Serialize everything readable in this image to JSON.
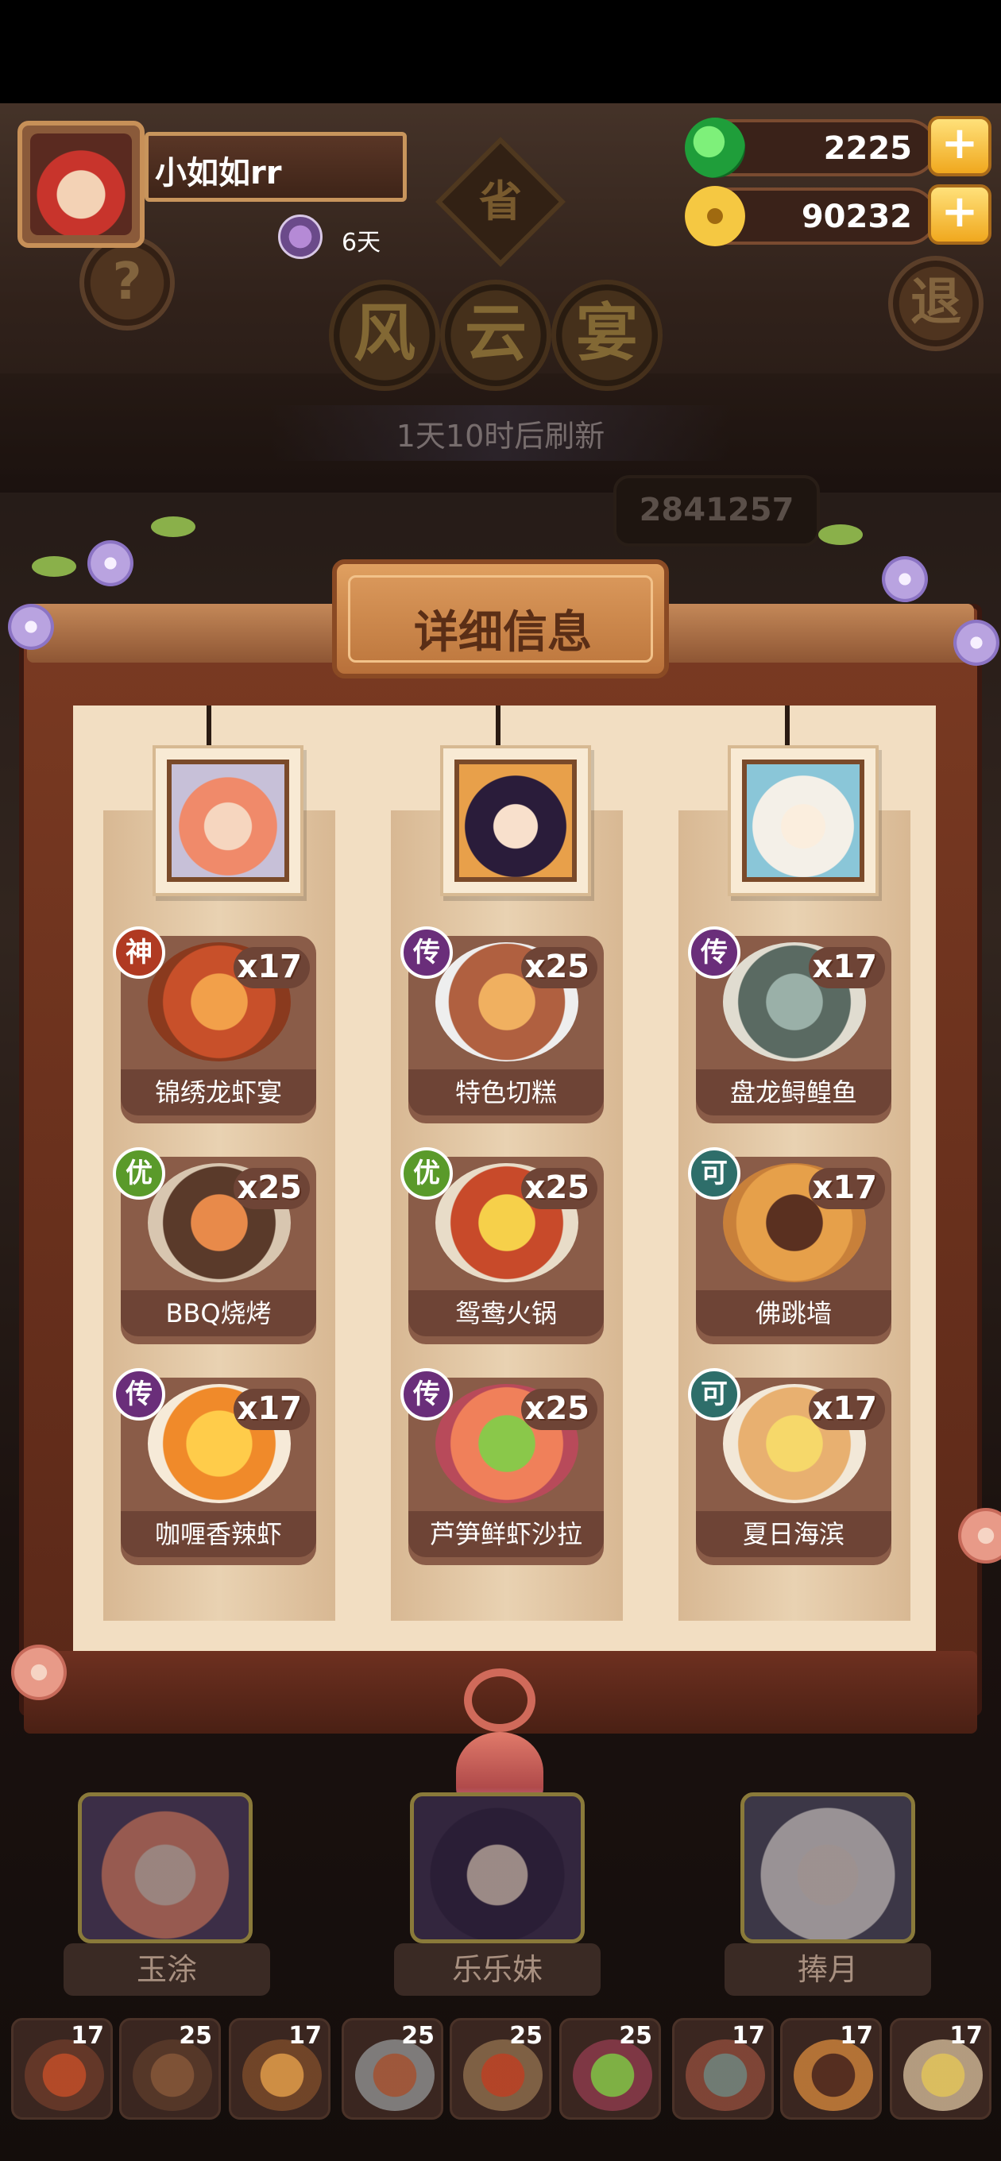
{
  "player": {
    "name": "小如如rr",
    "days": "6天"
  },
  "resources": {
    "jade": "2225",
    "coins": "90232",
    "plus": "+"
  },
  "buttons": {
    "help": "?",
    "exit": "退"
  },
  "event": {
    "province": "省",
    "title_chars": [
      "风",
      "云",
      "宴"
    ],
    "refresh": "1天10时后刷新",
    "score": "2841257"
  },
  "panel": {
    "title": "详细信息",
    "columns": [
      {
        "character": "玉涂",
        "dishes": [
          {
            "rank": "神",
            "count": "x17",
            "name": "锦绣龙虾宴"
          },
          {
            "rank": "优",
            "count": "x25",
            "name": "BBQ烧烤"
          },
          {
            "rank": "传",
            "count": "x17",
            "name": "咖喱香辣虾"
          }
        ]
      },
      {
        "character": "乐乐妹",
        "dishes": [
          {
            "rank": "传",
            "count": "x25",
            "name": "特色切糕"
          },
          {
            "rank": "优",
            "count": "x25",
            "name": "鸳鸯火锅"
          },
          {
            "rank": "传",
            "count": "x25",
            "name": "芦笋鲜虾沙拉"
          }
        ]
      },
      {
        "character": "捧月",
        "dishes": [
          {
            "rank": "传",
            "count": "x17",
            "name": "盘龙鲟鳇鱼"
          },
          {
            "rank": "可",
            "count": "x17",
            "name": "佛跳墙"
          },
          {
            "rank": "可",
            "count": "x17",
            "name": "夏日海滨"
          }
        ]
      }
    ]
  },
  "characters": [
    "玉涂",
    "乐乐妹",
    "捧月"
  ],
  "slots": [
    "17",
    "25",
    "17",
    "25",
    "25",
    "25",
    "17",
    "17",
    "17"
  ],
  "colors": {
    "rank_shen": "#b03a22",
    "rank_chuan": "#6a2e7a",
    "rank_you": "#5a9a2a",
    "rank_ke": "#2e6e6a"
  }
}
